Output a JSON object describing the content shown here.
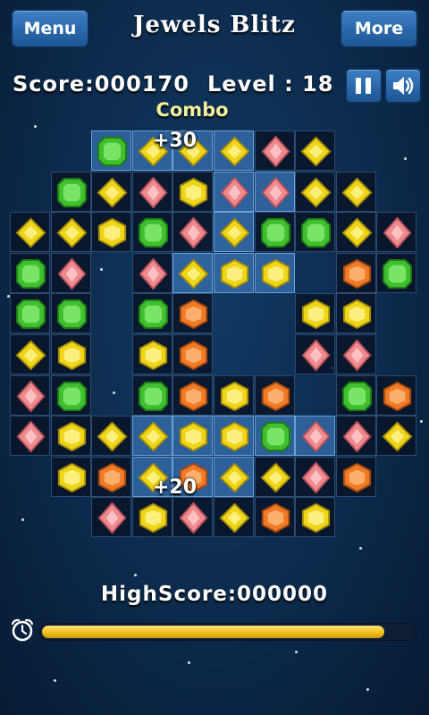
{
  "header": {
    "menu_label": "Menu",
    "title": "Jewels Blitz",
    "more_label": "More"
  },
  "hud": {
    "score_text": "Score:000170",
    "level_text": "Level : 18"
  },
  "combo": {
    "label": "Combo",
    "floaters": [
      "+30",
      "+20"
    ]
  },
  "footer": {
    "highscore_text": "HighScore:000000"
  },
  "timer": {
    "fraction_remaining": 0.92
  },
  "icons": {
    "pause": "pause-icon",
    "sound": "speaker-icon",
    "timer": "alarm-clock-icon"
  },
  "gem_colors": {
    "G": {
      "name": "green",
      "light": "#8ff07a",
      "mid": "#3fbf2d",
      "dark": "#1c7a14"
    },
    "Y": {
      "name": "yellow",
      "light": "#fff8a0",
      "mid": "#efd51a",
      "dark": "#a88e08"
    },
    "P": {
      "name": "pink",
      "light": "#ffd3d3",
      "mid": "#ee8a8e",
      "dark": "#b8515a"
    },
    "O": {
      "name": "orange",
      "light": "#ffc285",
      "mid": "#f07a25",
      "dark": "#a94a0d"
    }
  },
  "board": {
    "rows": [
      "..GDDDPD..",
      ".GDPHPPDD.",
      "DDHGPDGGDP",
      "GP.PDHH.OG",
      "GG.GO..HH.",
      "DH.HO..PP.",
      "PG.GOHO.GO",
      "PHDDHHGPPD",
      ".HODODDPO.",
      "..PHPDOH.."
    ],
    "highlighted": [
      [
        0,
        2
      ],
      [
        0,
        3
      ],
      [
        0,
        4
      ],
      [
        0,
        5
      ],
      [
        1,
        5
      ],
      [
        1,
        6
      ],
      [
        2,
        5
      ],
      [
        3,
        4
      ],
      [
        3,
        5
      ],
      [
        3,
        6
      ],
      [
        4,
        5
      ],
      [
        7,
        3
      ],
      [
        7,
        4
      ],
      [
        7,
        5
      ],
      [
        7,
        6
      ],
      [
        7,
        7
      ],
      [
        8,
        3
      ],
      [
        8,
        4
      ],
      [
        8,
        5
      ]
    ]
  }
}
